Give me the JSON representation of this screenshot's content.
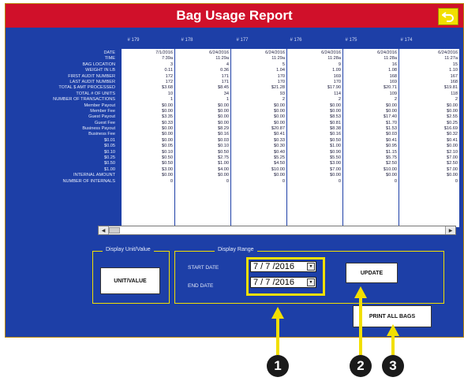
{
  "header": {
    "title": "Bag Usage Report"
  },
  "colors": {
    "title_bar": "#d0102a",
    "panel": "#1d3fa7",
    "highlight": "#f2df00",
    "back_button": "#f2df00"
  },
  "icons": {
    "back": "return-arrow-icon",
    "scroll_left": "scroll-left-arrow-icon",
    "scroll_right": "scroll-right-arrow-icon",
    "dropdown": "dropdown-arrow-icon"
  },
  "report": {
    "row_labels": [
      "DATE",
      "TIME",
      "BAG LOCATION",
      "WEIGHT IN LB",
      "FIRST AUDIT NUMBER",
      "LAST AUDIT NUMBER",
      "TOTAL $ AMT PROCESSED",
      "TOTAL # OF UNITS",
      "NUMBER OF TRANSACTIONS",
      "Member Payout",
      "Member Fee",
      "Guest Payout",
      "Guest Fee",
      "Business Payout",
      "Business Fee",
      "$0.01",
      "$0.05",
      "$0.10",
      "$0.25",
      "$0.50",
      "$1.00",
      "INTERNAL AMOUNT",
      "NUMBER OF INTERNALS"
    ],
    "columns": [
      {
        "header": "# 179",
        "values": [
          "7/1/2016",
          "7:39a",
          "3",
          "0.11",
          "172",
          "172",
          "$3.68",
          "10",
          "1",
          "$0.00",
          "$0.00",
          "$3.35",
          "$0.33",
          "$0.00",
          "$0.00",
          "$0.00",
          "$0.05",
          "$0.10",
          "$0.50",
          "$0.50",
          "$3.00",
          "$0.00",
          "0"
        ]
      },
      {
        "header": "# 178",
        "values": [
          "6/24/2016",
          "11:29a",
          "4",
          "0.36",
          "171",
          "171",
          "$8.45",
          "34",
          "1",
          "$0.00",
          "$0.00",
          "$0.00",
          "$0.00",
          "$8.29",
          "$0.16",
          "$0.03",
          "$0.10",
          "$0.50",
          "$2.75",
          "$1.00",
          "$4.00",
          "$0.00",
          "0"
        ]
      },
      {
        "header": "# 177",
        "values": [
          "6/24/2016",
          "11:29a",
          "5",
          "1.04",
          "170",
          "170",
          "$21.28",
          "93",
          "2",
          "$0.00",
          "$0.00",
          "$0.00",
          "$0.00",
          "$20.87",
          "$0.41",
          "$0.33",
          "$0.30",
          "$0.40",
          "$5.25",
          "$4.50",
          "$10.00",
          "$0.00",
          "0"
        ]
      },
      {
        "header": "# 176",
        "values": [
          "6/24/2016",
          "11:28a",
          "9",
          "1.09",
          "169",
          "170",
          "$17.90",
          "114",
          "2",
          "$0.00",
          "$0.00",
          "$8.53",
          "$0.81",
          "$8.38",
          "$0.16",
          "$0.50",
          "$1.00",
          "$0.90",
          "$5.50",
          "$3.00",
          "$7.00",
          "$0.00",
          "0"
        ]
      },
      {
        "header": "# 175",
        "values": [
          "6/24/2016",
          "11:28a",
          "16",
          "1.08",
          "168",
          "169",
          "$20.71",
          "109",
          "2",
          "$0.00",
          "$0.00",
          "$17.40",
          "$1.70",
          "$1.53",
          "$0.03",
          "$0.41",
          "$0.95",
          "$1.15",
          "$5.75",
          "$2.50",
          "$10.00",
          "$0.00",
          "0"
        ]
      },
      {
        "header": "# 174",
        "values": [
          "6/24/2016",
          "11:27a",
          "15",
          "1.10",
          "167",
          "168",
          "$19.81",
          "118",
          "2",
          "$0.00",
          "$0.00",
          "$2.55",
          "$0.25",
          "$16.69",
          "$0.32",
          "$0.41",
          "$0.00",
          "$2.10",
          "$7.00",
          "$2.50",
          "$7.00",
          "$0.00",
          "0"
        ]
      }
    ]
  },
  "display_unit": {
    "group_title": "Display Unit/Value",
    "button_label": "UNIT/VALUE"
  },
  "display_range": {
    "group_title": "Display Range",
    "start_label": "START DATE",
    "end_label": "END DATE",
    "start_value": "7 / 7 /2016",
    "end_value": "7 / 7 /2016"
  },
  "buttons": {
    "update": "UPDATE",
    "print_all": "PRINT ALL BAGS"
  },
  "callouts": [
    "1",
    "2",
    "3"
  ]
}
